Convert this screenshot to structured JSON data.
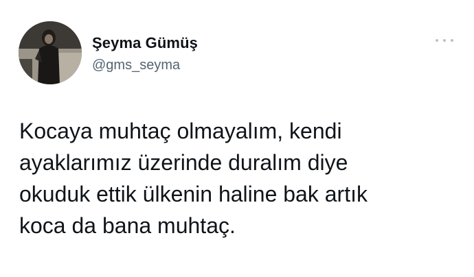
{
  "author": {
    "name": "Şeyma Gümüş",
    "handle": "@gms_seyma",
    "avatar_icon": "profile-photo"
  },
  "tweet": {
    "lines": [
      "Kocaya muhtaç olmayalım, kendi",
      "ayaklarımız üzerinde duralım diye",
      "okuduk ettik ülkenin haline bak artık",
      "koca da bana muhtaç."
    ]
  },
  "more_icon": "more-dots-icon",
  "colors": {
    "name": "#0f1419",
    "handle": "#536471",
    "text": "#0f1419",
    "more_dots": "#b9c2ca",
    "background": "#ffffff"
  }
}
